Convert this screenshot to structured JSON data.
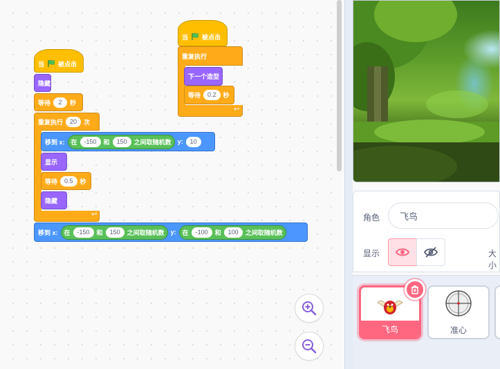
{
  "workspace": {
    "script1": {
      "hat": {
        "when_label": "当",
        "clicked_label": "被点击"
      },
      "hide1": "隐藏",
      "wait1": {
        "label": "等待",
        "value": "2",
        "unit": "秒"
      },
      "repeat": {
        "label": "重复执行",
        "value": "20",
        "unit": "次"
      },
      "goto": {
        "label": "移到 x:",
        "in": "在",
        "from": "-150",
        "and": "和",
        "to": "150",
        "random": "之间取随机数",
        "y_label": "y:",
        "y_value": "10"
      },
      "show": "显示",
      "wait2": {
        "label": "等待",
        "value": "0.5",
        "unit": "秒"
      },
      "hide2": "隐藏",
      "goto2": {
        "label": "移到 x:",
        "in": "在",
        "x_from": "-150",
        "and": "和",
        "x_to": "150",
        "random": "之间取随机数",
        "y_label": "y:",
        "y_in": "在",
        "y_from": "-100",
        "y_and": "和",
        "y_to": "100",
        "y_random": "之间取随机数"
      }
    },
    "script2": {
      "hat": {
        "when_label": "当",
        "clicked_label": "被点击"
      },
      "forever": "重复执行",
      "next_costume": "下一个造型",
      "wait": {
        "label": "等待",
        "value": "0.2",
        "unit": "秒"
      }
    }
  },
  "sprite_info": {
    "sprite_label": "角色",
    "sprite_name": "飞鸟",
    "show_label": "显示",
    "size_label": "大小"
  },
  "sprites": [
    {
      "name": "飞鸟",
      "selected": true
    },
    {
      "name": "准心",
      "selected": false
    }
  ],
  "colors": {
    "events": "#FFBF00",
    "control": "#FFAB19",
    "looks": "#9966FF",
    "motion": "#4C97FF",
    "operators": "#59C059",
    "selected": "#FF6680"
  }
}
